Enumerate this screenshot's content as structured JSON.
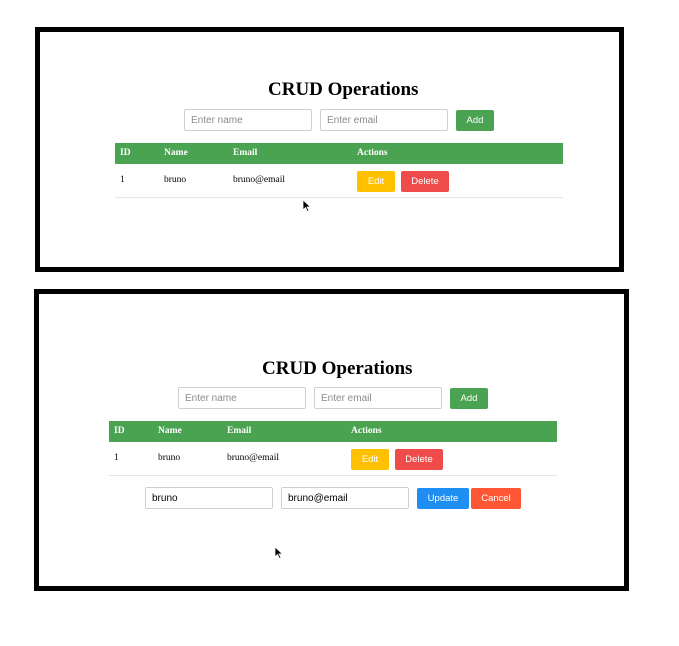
{
  "app": {
    "title": "CRUD Operations"
  },
  "form": {
    "name_placeholder": "Enter name",
    "email_placeholder": "Enter email",
    "add_label": "Add"
  },
  "table": {
    "headers": [
      "ID",
      "Name",
      "Email",
      "Actions"
    ],
    "rows": [
      {
        "id": "1",
        "name": "bruno",
        "email": "bruno@email",
        "edit_label": "Edit",
        "delete_label": "Delete"
      }
    ]
  },
  "edit_form": {
    "name_value": "bruno",
    "email_value": "bruno@email",
    "update_label": "Update",
    "cancel_label": "Cancel"
  },
  "colors": {
    "accent_green": "#4aa351",
    "edit_yellow": "#ffc000",
    "delete_red": "#ef4b4b",
    "update_blue": "#1e8ef3",
    "cancel_orange": "#ff5733"
  },
  "icons": {
    "cursor": "mouse-pointer-icon"
  }
}
